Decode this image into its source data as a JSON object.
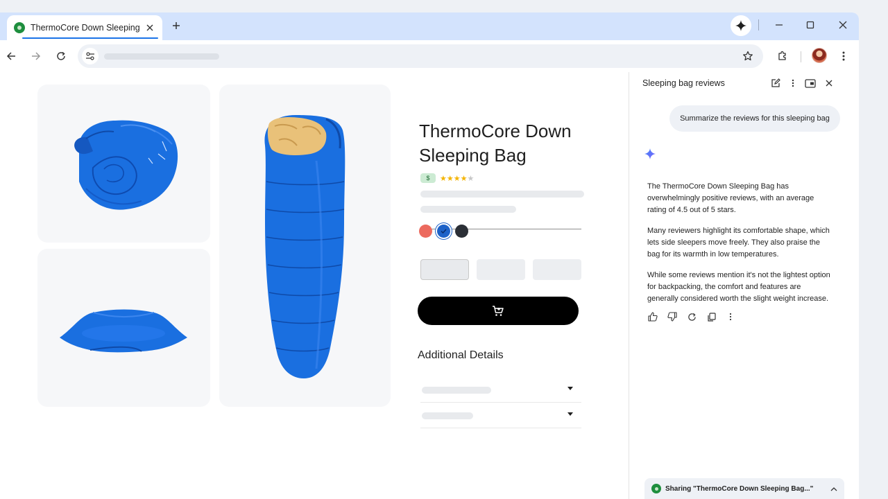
{
  "browser": {
    "tab": {
      "title": "ThermoCore Down Sleeping Bag",
      "favicon": "product-site-icon"
    },
    "new_tab_icon": "plus-icon",
    "window_controls": [
      "minimize-icon",
      "maximize-icon",
      "close-icon"
    ],
    "address_bar": {
      "url": "",
      "site_info_icon": "tune-icon"
    },
    "toolbar_icons": [
      "back-arrow-icon",
      "forward-arrow-icon",
      "reload-icon",
      "star-icon",
      "extensions-puzzle-icon",
      "avatar",
      "more-vert-icon"
    ],
    "accent": "#1a73e8",
    "tabstrip_color": "#d3e3fd"
  },
  "product": {
    "title": "ThermoCore Down Sleeping Bag",
    "price_badge": "$",
    "rating_stars": 4,
    "rating_max": 5,
    "star_color": "#f4b400",
    "colors": [
      {
        "name": "coral",
        "hex": "#ec6a5e",
        "selected": false
      },
      {
        "name": "blue",
        "hex": "#1d62c8",
        "selected": true
      },
      {
        "name": "charcoal",
        "hex": "#2b2f36",
        "selected": false
      }
    ],
    "sizes_count": 3,
    "cart_icon": "shopping-cart-icon",
    "additional_details_heading": "Additional Details",
    "accordion_rows": 2,
    "images": [
      "rolled-sleeping-bag",
      "pillow",
      "open-sleeping-bag"
    ],
    "product_color": "#1a6fe0",
    "lining_color": "#e9c179"
  },
  "side_panel": {
    "title": "Sleeping bag reviews",
    "header_icons": [
      "edit-icon",
      "more-vert-icon",
      "open-in-new-window-icon",
      "close-icon"
    ],
    "user_prompt": "Summarize the reviews for this sleeping bag",
    "response": [
      "The ThermoCore Down Sleeping Bag has overwhelmingly positive reviews, with an average rating of 4.5 out of 5 stars.",
      "Many reviewers highlight its comfortable shape, which lets side sleepers move freely. They also praise the bag for its warmth in low temperatures.",
      "While some reviews mention it's not the lightest option for backpacking, the comfort and features are generally considered worth the slight weight increase."
    ],
    "response_actions": [
      "thumbs-up-icon",
      "thumbs-down-icon",
      "regenerate-icon",
      "copy-icon",
      "more-vert-icon"
    ],
    "sharing_label": "Sharing \"ThermoCore Down Sleeping Bag...\""
  }
}
